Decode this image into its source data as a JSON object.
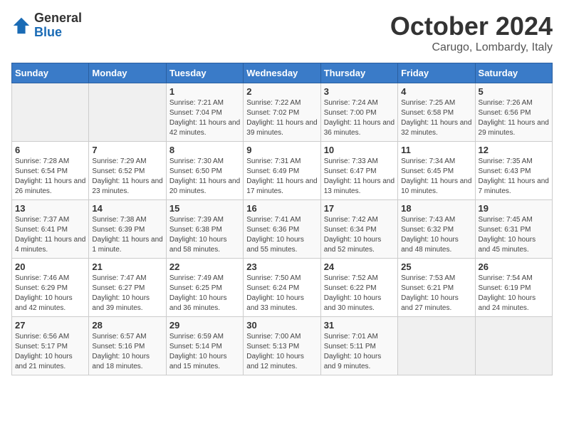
{
  "logo": {
    "general": "General",
    "blue": "Blue"
  },
  "header": {
    "month_year": "October 2024",
    "location": "Carugo, Lombardy, Italy"
  },
  "weekdays": [
    "Sunday",
    "Monday",
    "Tuesday",
    "Wednesday",
    "Thursday",
    "Friday",
    "Saturday"
  ],
  "weeks": [
    [
      {
        "day": "",
        "info": ""
      },
      {
        "day": "",
        "info": ""
      },
      {
        "day": "1",
        "info": "Sunrise: 7:21 AM\nSunset: 7:04 PM\nDaylight: 11 hours and 42 minutes."
      },
      {
        "day": "2",
        "info": "Sunrise: 7:22 AM\nSunset: 7:02 PM\nDaylight: 11 hours and 39 minutes."
      },
      {
        "day": "3",
        "info": "Sunrise: 7:24 AM\nSunset: 7:00 PM\nDaylight: 11 hours and 36 minutes."
      },
      {
        "day": "4",
        "info": "Sunrise: 7:25 AM\nSunset: 6:58 PM\nDaylight: 11 hours and 32 minutes."
      },
      {
        "day": "5",
        "info": "Sunrise: 7:26 AM\nSunset: 6:56 PM\nDaylight: 11 hours and 29 minutes."
      }
    ],
    [
      {
        "day": "6",
        "info": "Sunrise: 7:28 AM\nSunset: 6:54 PM\nDaylight: 11 hours and 26 minutes."
      },
      {
        "day": "7",
        "info": "Sunrise: 7:29 AM\nSunset: 6:52 PM\nDaylight: 11 hours and 23 minutes."
      },
      {
        "day": "8",
        "info": "Sunrise: 7:30 AM\nSunset: 6:50 PM\nDaylight: 11 hours and 20 minutes."
      },
      {
        "day": "9",
        "info": "Sunrise: 7:31 AM\nSunset: 6:49 PM\nDaylight: 11 hours and 17 minutes."
      },
      {
        "day": "10",
        "info": "Sunrise: 7:33 AM\nSunset: 6:47 PM\nDaylight: 11 hours and 13 minutes."
      },
      {
        "day": "11",
        "info": "Sunrise: 7:34 AM\nSunset: 6:45 PM\nDaylight: 11 hours and 10 minutes."
      },
      {
        "day": "12",
        "info": "Sunrise: 7:35 AM\nSunset: 6:43 PM\nDaylight: 11 hours and 7 minutes."
      }
    ],
    [
      {
        "day": "13",
        "info": "Sunrise: 7:37 AM\nSunset: 6:41 PM\nDaylight: 11 hours and 4 minutes."
      },
      {
        "day": "14",
        "info": "Sunrise: 7:38 AM\nSunset: 6:39 PM\nDaylight: 11 hours and 1 minute."
      },
      {
        "day": "15",
        "info": "Sunrise: 7:39 AM\nSunset: 6:38 PM\nDaylight: 10 hours and 58 minutes."
      },
      {
        "day": "16",
        "info": "Sunrise: 7:41 AM\nSunset: 6:36 PM\nDaylight: 10 hours and 55 minutes."
      },
      {
        "day": "17",
        "info": "Sunrise: 7:42 AM\nSunset: 6:34 PM\nDaylight: 10 hours and 52 minutes."
      },
      {
        "day": "18",
        "info": "Sunrise: 7:43 AM\nSunset: 6:32 PM\nDaylight: 10 hours and 48 minutes."
      },
      {
        "day": "19",
        "info": "Sunrise: 7:45 AM\nSunset: 6:31 PM\nDaylight: 10 hours and 45 minutes."
      }
    ],
    [
      {
        "day": "20",
        "info": "Sunrise: 7:46 AM\nSunset: 6:29 PM\nDaylight: 10 hours and 42 minutes."
      },
      {
        "day": "21",
        "info": "Sunrise: 7:47 AM\nSunset: 6:27 PM\nDaylight: 10 hours and 39 minutes."
      },
      {
        "day": "22",
        "info": "Sunrise: 7:49 AM\nSunset: 6:25 PM\nDaylight: 10 hours and 36 minutes."
      },
      {
        "day": "23",
        "info": "Sunrise: 7:50 AM\nSunset: 6:24 PM\nDaylight: 10 hours and 33 minutes."
      },
      {
        "day": "24",
        "info": "Sunrise: 7:52 AM\nSunset: 6:22 PM\nDaylight: 10 hours and 30 minutes."
      },
      {
        "day": "25",
        "info": "Sunrise: 7:53 AM\nSunset: 6:21 PM\nDaylight: 10 hours and 27 minutes."
      },
      {
        "day": "26",
        "info": "Sunrise: 7:54 AM\nSunset: 6:19 PM\nDaylight: 10 hours and 24 minutes."
      }
    ],
    [
      {
        "day": "27",
        "info": "Sunrise: 6:56 AM\nSunset: 5:17 PM\nDaylight: 10 hours and 21 minutes."
      },
      {
        "day": "28",
        "info": "Sunrise: 6:57 AM\nSunset: 5:16 PM\nDaylight: 10 hours and 18 minutes."
      },
      {
        "day": "29",
        "info": "Sunrise: 6:59 AM\nSunset: 5:14 PM\nDaylight: 10 hours and 15 minutes."
      },
      {
        "day": "30",
        "info": "Sunrise: 7:00 AM\nSunset: 5:13 PM\nDaylight: 10 hours and 12 minutes."
      },
      {
        "day": "31",
        "info": "Sunrise: 7:01 AM\nSunset: 5:11 PM\nDaylight: 10 hours and 9 minutes."
      },
      {
        "day": "",
        "info": ""
      },
      {
        "day": "",
        "info": ""
      }
    ]
  ]
}
